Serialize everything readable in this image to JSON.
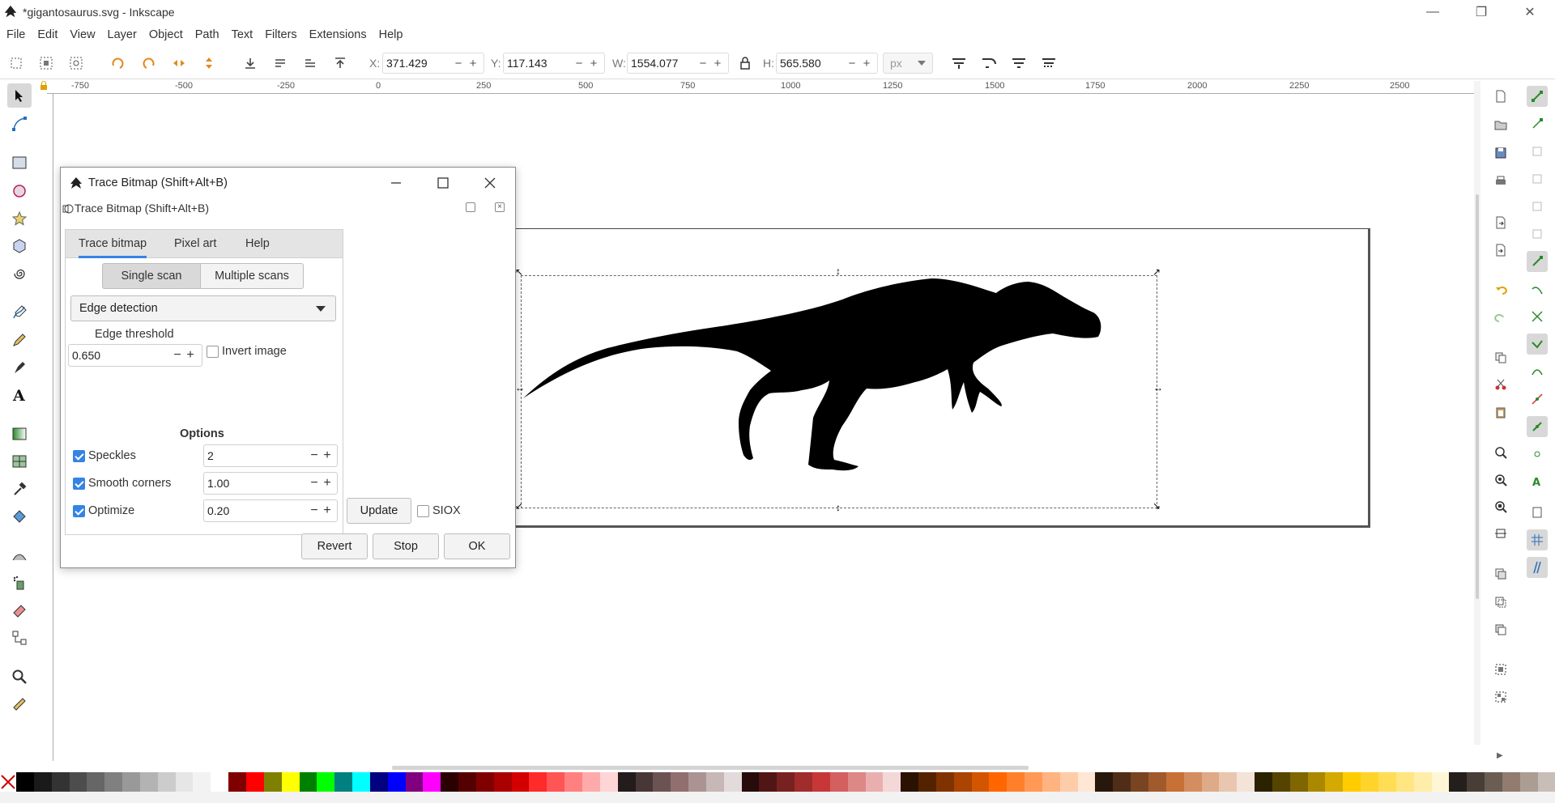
{
  "window": {
    "title": "*gigantosaurus.svg - Inkscape",
    "controls": {
      "minimize": "—",
      "restore": "❐",
      "close": "✕"
    }
  },
  "menu": [
    "File",
    "Edit",
    "View",
    "Layer",
    "Object",
    "Path",
    "Text",
    "Filters",
    "Extensions",
    "Help"
  ],
  "toolbar": {
    "x_label": "X:",
    "x_value": "371.429",
    "y_label": "Y:",
    "y_value": "117.143",
    "w_label": "W:",
    "w_value": "1554.077",
    "h_label": "H:",
    "h_value": "565.580",
    "unit": "px",
    "minus": "−",
    "plus": "+"
  },
  "ruler": {
    "horizontal": [
      "-750",
      "-500",
      "-250",
      "0",
      "250",
      "500",
      "750",
      "1000",
      "1250",
      "1500",
      "1750",
      "2000",
      "2250",
      "2500"
    ]
  },
  "dialog": {
    "title": "Trace Bitmap (Shift+Alt+B)",
    "panel_title": "Trace Bitmap (Shift+Alt+B)",
    "tabs": [
      "Trace bitmap",
      "Pixel art",
      "Help"
    ],
    "scan_modes": [
      "Single scan",
      "Multiple scans"
    ],
    "mode": "Edge detection",
    "edge_threshold_label": "Edge threshold",
    "edge_threshold_value": "0.650",
    "invert_label": "Invert image",
    "options_header": "Options",
    "speckles_label": "Speckles",
    "speckles_value": "2",
    "smooth_label": "Smooth corners",
    "smooth_value": "1.00",
    "optimize_label": "Optimize",
    "optimize_value": "0.20",
    "update_label": "Update",
    "siox_label": "SIOX",
    "revert_label": "Revert",
    "stop_label": "Stop",
    "ok_label": "OK",
    "minus": "−",
    "plus": "+"
  },
  "colors": {
    "accent": "#3584e4",
    "palette": [
      "#000000",
      "#1a1a1a",
      "#333333",
      "#4d4d4d",
      "#666666",
      "#808080",
      "#999999",
      "#b3b3b3",
      "#cccccc",
      "#e6e6e6",
      "#f2f2f2",
      "#ffffff",
      "#800000",
      "#ff0000",
      "#808000",
      "#ffff00",
      "#008000",
      "#00ff00",
      "#008080",
      "#00ffff",
      "#000080",
      "#0000ff",
      "#800080",
      "#ff00ff",
      "#2b0000",
      "#550000",
      "#800000",
      "#aa0000",
      "#d40000",
      "#ff2a2a",
      "#ff5555",
      "#ff8080",
      "#ffaaaa",
      "#ffd5d5",
      "#241c1c",
      "#483737",
      "#6c5353",
      "#916f6f",
      "#ac9393",
      "#c8b7b7",
      "#e3dbdb",
      "#280b0b",
      "#501616",
      "#782121",
      "#a02c2c",
      "#c83737",
      "#d35f5f",
      "#de8787",
      "#e9afaf",
      "#f4d7d7",
      "#2b1100",
      "#552200",
      "#803300",
      "#aa4400",
      "#d45500",
      "#ff6600",
      "#ff7f2a",
      "#ff9955",
      "#ffb380",
      "#ffccaa",
      "#ffe6d5",
      "#28170b",
      "#502d16",
      "#784421",
      "#a05a2c",
      "#c87137",
      "#d38d5f",
      "#deaa87",
      "#e9c6af",
      "#f4e3d7",
      "#2b2200",
      "#554400",
      "#806600",
      "#aa8800",
      "#d4aa00",
      "#ffcc00",
      "#ffd42a",
      "#ffdd55",
      "#ffe680",
      "#ffeeaa",
      "#fff6d5",
      "#241f1c",
      "#483e37",
      "#6c5d53",
      "#917c6f",
      "#ac9d93",
      "#c8beb7"
    ]
  }
}
